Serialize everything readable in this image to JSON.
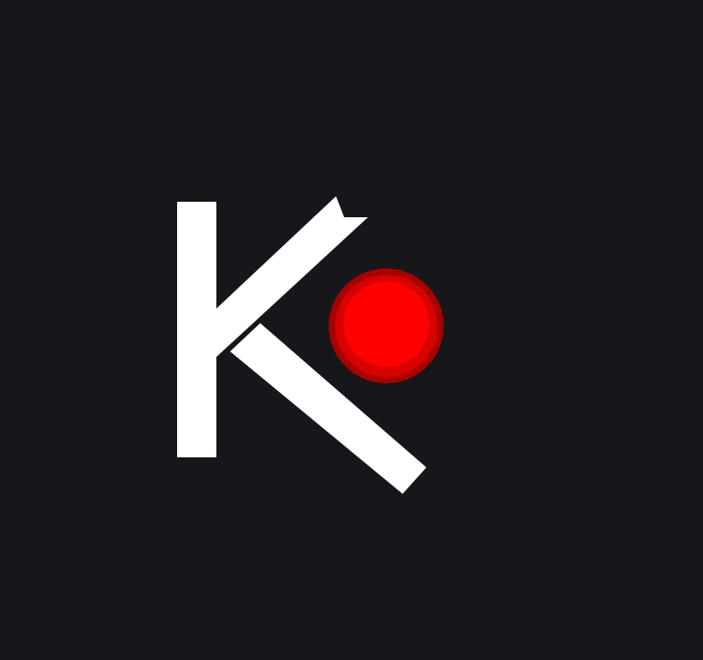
{
  "background_color": "#16171b",
  "logo": {
    "glyph_color": "#ffffff",
    "dot": {
      "outer_color": "#a60000",
      "mid_color": "#d90000",
      "inner_color": "#ff0000"
    }
  },
  "icons": {
    "letter_mark": "k-letter-icon",
    "dot_mark": "red-dot-icon"
  }
}
